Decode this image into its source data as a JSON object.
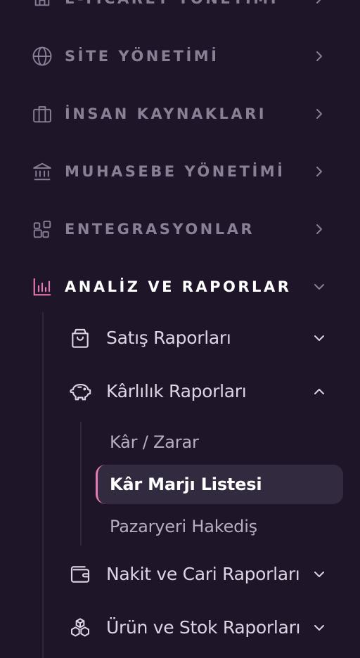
{
  "colors": {
    "background": "#1e1628",
    "accent": "#e879b4",
    "muted_text": "#8a7f97",
    "active_text": "#ffffff",
    "active_bg": "#322a3e"
  },
  "nav": [
    {
      "label": "E-TİCARET YÖNETİMİ",
      "icon": "store-icon",
      "expanded": false
    },
    {
      "label": "SİTE YÖNETİMİ",
      "icon": "globe-icon",
      "expanded": false
    },
    {
      "label": "İNSAN KAYNAKLARI",
      "icon": "briefcase-icon",
      "expanded": false
    },
    {
      "label": "MUHASEBE YÖNETİMİ",
      "icon": "bank-icon",
      "expanded": false
    },
    {
      "label": "ENTEGRASYONLAR",
      "icon": "integrations-icon",
      "expanded": false
    },
    {
      "label": "ANALİZ VE RAPORLAR",
      "icon": "bar-chart-icon",
      "expanded": true,
      "active": true
    }
  ],
  "reports": {
    "sales": {
      "label": "Satış Raporları",
      "icon": "shopping-bag-icon",
      "expanded": false
    },
    "profit": {
      "label": "Kârlılık Raporları",
      "icon": "piggy-bank-icon",
      "expanded": true,
      "children": [
        {
          "label": "Kâr / Zarar",
          "active": false
        },
        {
          "label": "Kâr Marjı Listesi",
          "active": true
        },
        {
          "label": "Pazaryeri Hakediş",
          "active": false
        }
      ]
    },
    "cash": {
      "label": "Nakit ve Cari Raporları",
      "icon": "wallet-icon",
      "expanded": false
    },
    "stock": {
      "label": "Ürün ve Stok Raporları",
      "icon": "boxes-icon",
      "expanded": false
    }
  }
}
